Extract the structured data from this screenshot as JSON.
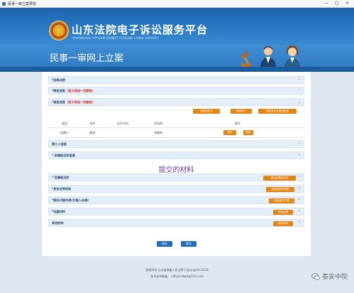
{
  "window": {
    "title": "民事一审立案预览",
    "controls": [
      "—",
      "□",
      "✕"
    ]
  },
  "header": {
    "title": "山东法院电子诉讼服务平台",
    "subtitle": "SHANDONG FAYUAN DIANZI SUSONG FUWU PINGTAI"
  },
  "banner": {
    "title": "民事一审网上立案"
  },
  "sections": {
    "court": {
      "label": "*选择法院"
    },
    "plaintiff": {
      "label": "*原告信息",
      "note": "（至少添加一位原告）"
    },
    "defendant": {
      "label": "*被告信息",
      "note": "（至少添加一位被告）"
    },
    "third_party": {
      "label": "第三人信息"
    },
    "complaint_info": {
      "label": "* 民事起诉状信息"
    }
  },
  "defendant_buttons": {
    "add_natural_person": "添加自然人",
    "add_legal_person": "添加法人",
    "add_unincorporated": "添加非法人组织信息"
  },
  "party_table": {
    "headers": [
      "类型",
      "名称",
      "证件号码",
      "住所地",
      "操作"
    ],
    "rows": [
      {
        "type": "自然人",
        "name": "测试",
        "id_number": "",
        "address": "济南市",
        "edit": "修改",
        "delete": "删除"
      }
    ]
  },
  "materials": {
    "title": "提交的材料",
    "items": [
      {
        "label": "* 民事起诉状",
        "button": "添加民事起诉状"
      },
      {
        "label": "*身份证明材料",
        "button": "添加身份证材料"
      },
      {
        "label": "*委托代理手续(代理人必填)",
        "button": "添加委托代理"
      },
      {
        "label": "*证据材料",
        "button": "添加证据"
      },
      {
        "label": "其他材料",
        "button": "添加材料"
      }
    ]
  },
  "actions": {
    "save": "保存",
    "submit": "提交"
  },
  "footer": {
    "copyright": "版权所有:山东省高级人民法院 Copyright©2018",
    "support": "技术支持邮箱：    sdfydzsfwpt@163.com"
  },
  "watermark": {
    "text": "泰安中院"
  },
  "colors": {
    "accent_orange": "#e78514",
    "primary_blue": "#1f6ebd",
    "header_blue": "#1d63ad",
    "required_red": "#d8221d"
  }
}
